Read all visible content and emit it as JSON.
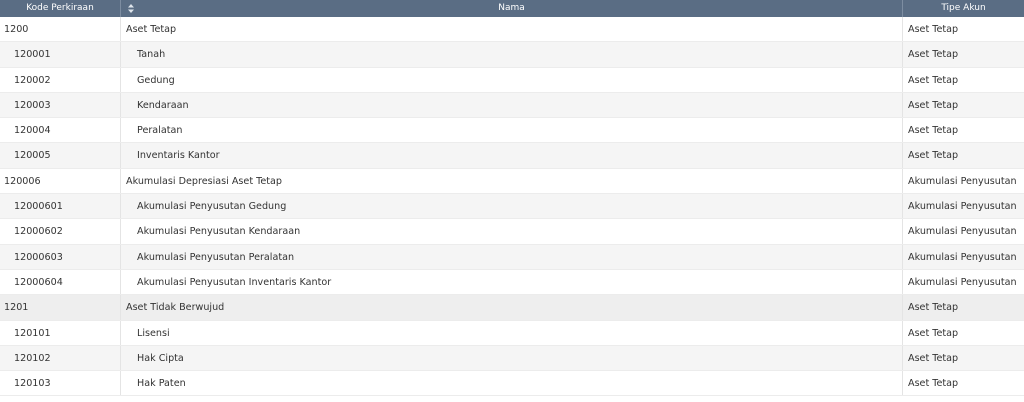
{
  "header": {
    "kode_label": "Kode Perkiraan",
    "nama_label": "Nama",
    "tipe_label": "Tipe Akun"
  },
  "rows": [
    {
      "kode": "1200",
      "nama": "Aset Tetap",
      "tipe": "Aset Tetap",
      "level": 0
    },
    {
      "kode": "120001",
      "nama": "Tanah",
      "tipe": "Aset Tetap",
      "level": 1
    },
    {
      "kode": "120002",
      "nama": "Gedung",
      "tipe": "Aset Tetap",
      "level": 1
    },
    {
      "kode": "120003",
      "nama": "Kendaraan",
      "tipe": "Aset Tetap",
      "level": 1
    },
    {
      "kode": "120004",
      "nama": "Peralatan",
      "tipe": "Aset Tetap",
      "level": 1
    },
    {
      "kode": "120005",
      "nama": "Inventaris Kantor",
      "tipe": "Aset Tetap",
      "level": 1
    },
    {
      "kode": "120006",
      "nama": "Akumulasi Depresiasi Aset Tetap",
      "tipe": "Akumulasi Penyusutan",
      "level": 0
    },
    {
      "kode": "12000601",
      "nama": "Akumulasi Penyusutan Gedung",
      "tipe": "Akumulasi Penyusutan",
      "level": 1
    },
    {
      "kode": "12000602",
      "nama": "Akumulasi Penyusutan Kendaraan",
      "tipe": "Akumulasi Penyusutan",
      "level": 1
    },
    {
      "kode": "12000603",
      "nama": "Akumulasi Penyusutan Peralatan",
      "tipe": "Akumulasi Penyusutan",
      "level": 1
    },
    {
      "kode": "12000604",
      "nama": "Akumulasi Penyusutan Inventaris Kantor",
      "tipe": "Akumulasi Penyusutan",
      "level": 1
    },
    {
      "kode": "1201",
      "nama": "Aset Tidak Berwujud",
      "tipe": "Aset Tetap",
      "level": 0
    },
    {
      "kode": "120101",
      "nama": "Lisensi",
      "tipe": "Aset Tetap",
      "level": 1
    },
    {
      "kode": "120102",
      "nama": "Hak Cipta",
      "tipe": "Aset Tetap",
      "level": 1
    },
    {
      "kode": "120103",
      "nama": "Hak Paten",
      "tipe": "Aset Tetap",
      "level": 1
    }
  ],
  "colors": {
    "header_bg": "#5a6d84",
    "row_alt_bg": "#f5f5f5",
    "group_alt_bg": "#eeeeee"
  },
  "icons": {
    "sort": "sort-icon"
  }
}
